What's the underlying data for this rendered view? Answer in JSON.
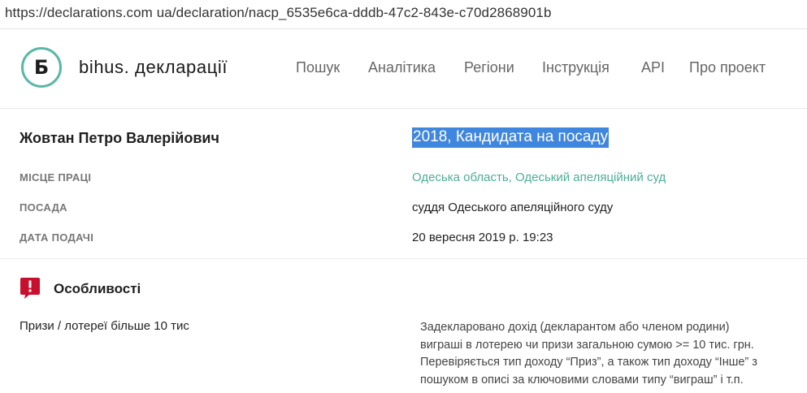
{
  "browser": {
    "url": "https://declarations.com ua/declaration/nacp_6535e6ca-dddb-47c2-843e-c70d2868901b"
  },
  "header": {
    "logo_glyph": "Б",
    "brand": "bihus. декларації",
    "nav": [
      "Пошук",
      "Аналітика",
      "Регіони",
      "Інструкція",
      "API",
      "Про проект"
    ]
  },
  "declaration": {
    "name": "Жовтан Петро Валерійович",
    "type": "2018, Кандидата на посаду",
    "fields": [
      {
        "label": "МІСЦЕ ПРАЦІ",
        "links": [
          "Одеська область",
          "Одеський апеляційний суд"
        ],
        "separator": ", "
      },
      {
        "label": "ПОСАДА",
        "value": "суддя Одеського апеляційного суду"
      },
      {
        "label": "ДАТА ПОДАЧІ",
        "value": "20 вересня 2019 р. 19:23"
      }
    ]
  },
  "features": {
    "title": "Особливості",
    "icon": "alert-icon",
    "icon_color": "#c8102e",
    "items": [
      {
        "name": "Призи / лотереї більше 10 тис",
        "description_lines": [
          "Задекларовано дохід (декларантом або членом родини)",
          "виграші в лотерею чи призи загальною сумою >= 10 тис. грн.",
          "Перевіряється тип доходу “Приз”, а також тип доходу “Інше” з",
          "пошуком в описі за ключовими словами типу “виграш” і т.п."
        ]
      }
    ]
  },
  "colors": {
    "accent": "#4cae97",
    "logo_ring": "#5ab8a8",
    "selection": "#3f86de",
    "alert": "#c8102e"
  }
}
